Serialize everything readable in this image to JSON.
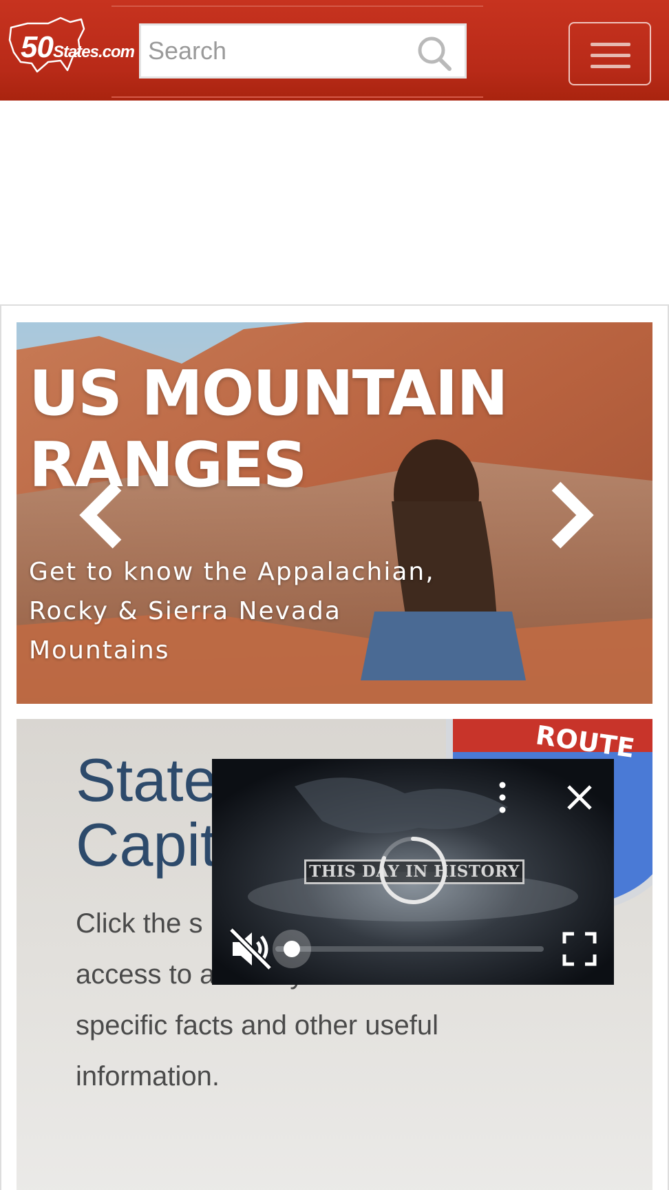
{
  "header": {
    "logo_big": "50",
    "logo_small": "States.com",
    "search_placeholder": "Search",
    "icons": {
      "search": "search-icon",
      "menu": "hamburger-menu-icon"
    }
  },
  "carousel": {
    "title": "US MOUNTAIN\nRANGES",
    "subtitle": "Get to know the Appalachian,\nRocky & Sierra Nevada\nMountains",
    "icons": {
      "prev": "chevron-left-icon",
      "next": "chevron-right-icon"
    }
  },
  "capitals": {
    "title": "State\nCapit",
    "body": "Click the s interested quick access to a variety of state specific facts and other useful information.",
    "sign_text": "ROUTE"
  },
  "video": {
    "caption": "THIS DAY IN HISTORY",
    "icons": {
      "more": "more-vertical-icon",
      "close": "close-icon",
      "mute": "volume-muted-icon",
      "fullscreen": "fullscreen-icon",
      "loading": "loading-spinner-icon"
    }
  },
  "colors": {
    "header_red": "#b82a18",
    "title_blue": "#2d4a6b",
    "body_gray": "#4a4a4a",
    "video_bg": "#0c0f14"
  }
}
